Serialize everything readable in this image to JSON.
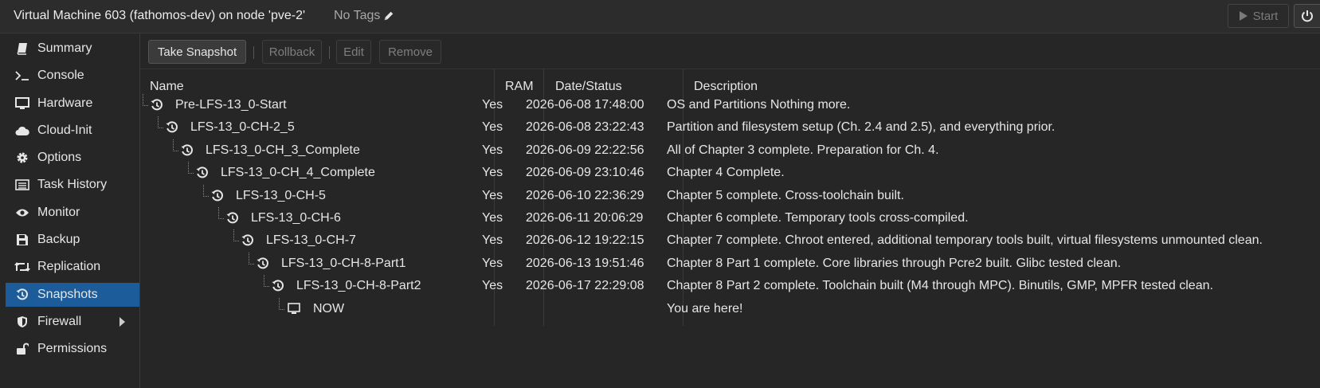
{
  "header": {
    "title": "Virtual Machine 603 (fathomos-dev) on node 'pve-2'",
    "tags": "No Tags",
    "start_label": "Start"
  },
  "sidebar": {
    "items": [
      {
        "label": "Summary",
        "icon": "book-icon"
      },
      {
        "label": "Console",
        "icon": "terminal-icon"
      },
      {
        "label": "Hardware",
        "icon": "monitor-icon"
      },
      {
        "label": "Cloud-Init",
        "icon": "cloud-icon"
      },
      {
        "label": "Options",
        "icon": "gear-icon"
      },
      {
        "label": "Task History",
        "icon": "list-icon"
      },
      {
        "label": "Monitor",
        "icon": "eye-icon"
      },
      {
        "label": "Backup",
        "icon": "floppy-icon"
      },
      {
        "label": "Replication",
        "icon": "retweet-icon"
      },
      {
        "label": "Snapshots",
        "icon": "history-icon",
        "active": true
      },
      {
        "label": "Firewall",
        "icon": "shield-icon",
        "has_submenu": true
      },
      {
        "label": "Permissions",
        "icon": "unlock-icon"
      }
    ]
  },
  "toolbar": {
    "take_snapshot": "Take Snapshot",
    "rollback": "Rollback",
    "edit": "Edit",
    "remove": "Remove"
  },
  "table": {
    "columns": [
      "Name",
      "RAM",
      "Date/Status",
      "Description"
    ],
    "rows": [
      {
        "name": "Pre-LFS-13_0-Start",
        "ram": "Yes",
        "date": "2026-06-08 17:48:00",
        "description": "OS and Partitions Nothing more."
      },
      {
        "name": "LFS-13_0-CH-2_5",
        "ram": "Yes",
        "date": "2026-06-08 23:22:43",
        "description": "Partition and filesystem setup (Ch. 2.4 and 2.5), and everything prior."
      },
      {
        "name": "LFS-13_0-CH_3_Complete",
        "ram": "Yes",
        "date": "2026-06-09 22:22:56",
        "description": "All of Chapter 3 complete. Preparation for Ch. 4."
      },
      {
        "name": "LFS-13_0-CH_4_Complete",
        "ram": "Yes",
        "date": "2026-06-09 23:10:46",
        "description": "Chapter 4 Complete."
      },
      {
        "name": "LFS-13_0-CH-5",
        "ram": "Yes",
        "date": "2026-06-10 22:36:29",
        "description": "Chapter 5 complete. Cross-toolchain built."
      },
      {
        "name": "LFS-13_0-CH-6",
        "ram": "Yes",
        "date": "2026-06-11 20:06:29",
        "description": "Chapter 6 complete. Temporary tools cross-compiled."
      },
      {
        "name": "LFS-13_0-CH-7",
        "ram": "Yes",
        "date": "2026-06-12 19:22:15",
        "description": "Chapter 7 complete. Chroot entered, additional temporary tools built, virtual filesystems unmounted clean."
      },
      {
        "name": "LFS-13_0-CH-8-Part1",
        "ram": "Yes",
        "date": "2026-06-13 19:51:46",
        "description": "Chapter 8 Part 1 complete. Core libraries through Pcre2 built. Glibc tested clean."
      },
      {
        "name": "LFS-13_0-CH-8-Part2",
        "ram": "Yes",
        "date": "2026-06-17 22:29:08",
        "description": "Chapter 8 Part 2 complete. Toolchain built (M4 through MPC). Binutils, GMP, MPFR tested clean."
      },
      {
        "name": "NOW",
        "ram": "",
        "date": "",
        "description": "You are here!",
        "current": true
      }
    ]
  }
}
